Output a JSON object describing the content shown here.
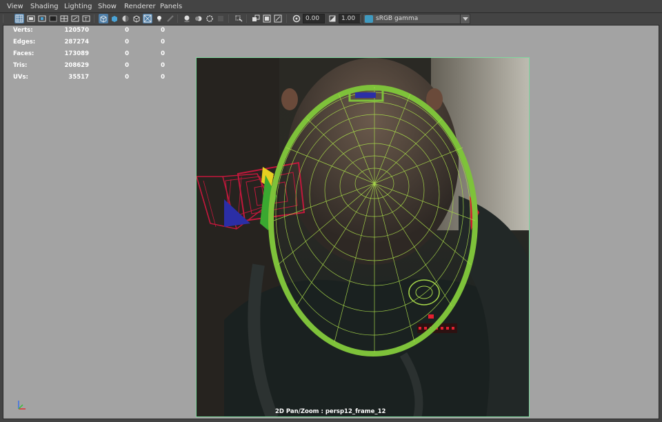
{
  "menubar": {
    "items": [
      "View",
      "Shading",
      "Lighting",
      "Show",
      "Renderer",
      "Panels"
    ]
  },
  "toolbar": {
    "exposure_value": "0.00",
    "gamma_value": "1.00",
    "colorspace": "sRGB gamma",
    "icons": [
      "select-camera-icon",
      "camera-attributes-icon",
      "bookmark-icon",
      "image-plane-icon",
      "grid-icon",
      "film-gate-icon",
      "resolution-gate-icon",
      "gate-mask-icon",
      "field-chart-icon",
      "safe-action-icon",
      "safe-title-icon",
      "wireframe-icon",
      "smooth-shade-icon",
      "default-material-icon",
      "xray-icon",
      "wireframe-on-shaded-icon",
      "textured-icon",
      "lights-icon",
      "shadows-icon",
      "ambient-occlusion-icon",
      "motion-blur-icon",
      "antialiasing-icon",
      "depth-of-field-icon",
      "isolate-select-icon",
      "xray-joints-icon",
      "xray-active-icon",
      "backface-icon",
      "exposure-icon",
      "gamma-icon",
      "colorspace-icon"
    ]
  },
  "hud": {
    "rows": [
      {
        "label": "Verts:",
        "v1": "120570",
        "v2": "0",
        "v3": "0"
      },
      {
        "label": "Edges:",
        "v1": "287274",
        "v2": "0",
        "v3": "0"
      },
      {
        "label": "Faces:",
        "v1": "173089",
        "v2": "0",
        "v3": "0"
      },
      {
        "label": "Tris:",
        "v1": "208629",
        "v2": "0",
        "v3": "0"
      },
      {
        "label": "UVs:",
        "v1": "35517",
        "v2": "0",
        "v3": "0"
      }
    ]
  },
  "viewport": {
    "pan_zoom_label": "2D Pan/Zoom : persp12_frame_12"
  },
  "colors": {
    "ui_bg": "#444444",
    "viewport_bg": "#a3a3a3",
    "head_mesh": "#7ec23a",
    "camera_wire": "#c2183c",
    "gate_border": "#7fd99e",
    "active_icon": "#4e7ea8"
  }
}
